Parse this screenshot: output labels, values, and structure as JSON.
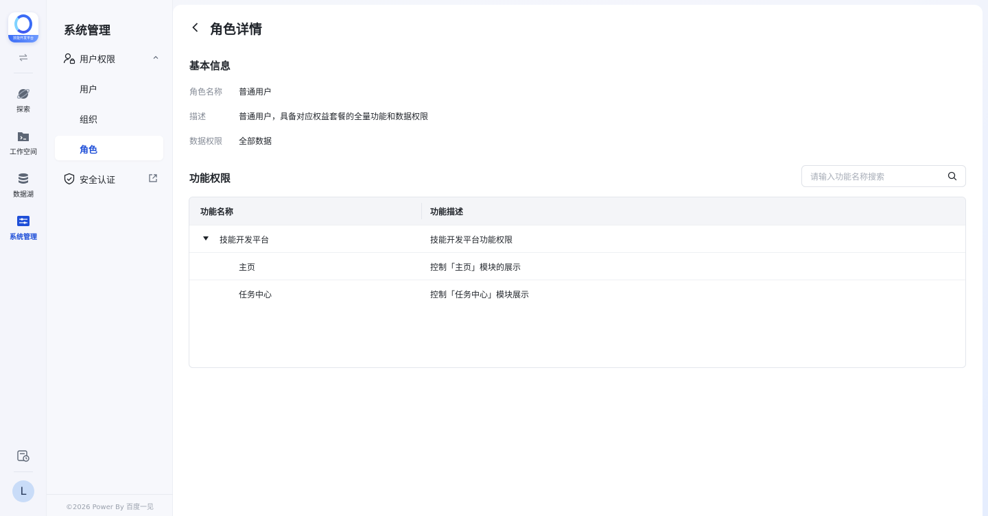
{
  "app": {
    "logo_text": "技能开发平台"
  },
  "rail": {
    "items": [
      {
        "label": "探索",
        "icon": "planet-icon"
      },
      {
        "label": "工作空间",
        "icon": "terminal-folder-icon"
      },
      {
        "label": "数据湖",
        "icon": "database-icon"
      },
      {
        "label": "系统管理",
        "icon": "system-settings-icon",
        "active": true
      }
    ],
    "avatar": "L"
  },
  "sidebar": {
    "title": "系统管理",
    "group": {
      "label": "用户权限",
      "expanded": true
    },
    "sub_items": [
      {
        "label": "用户"
      },
      {
        "label": "组织"
      },
      {
        "label": "角色",
        "active": true
      }
    ],
    "external_item": {
      "label": "安全认证"
    },
    "footer": "©2026 Power By 百度一见"
  },
  "main": {
    "title": "角色详情",
    "basic_info_title": "基本信息",
    "basic_info": [
      {
        "key": "角色名称",
        "value": "普通用户"
      },
      {
        "key": "描述",
        "value": "普通用户，具备对应权益套餐的全量功能和数据权限"
      },
      {
        "key": "数据权限",
        "value": "全部数据"
      }
    ],
    "permissions_title": "功能权限",
    "search": {
      "placeholder": "请输入功能名称搜索",
      "value": ""
    },
    "table": {
      "columns": [
        "功能名称",
        "功能描述"
      ],
      "rows": [
        {
          "name": "技能开发平台",
          "desc": "技能开发平台功能权限",
          "expandable": true,
          "expanded": true,
          "level": 0
        },
        {
          "name": "主页",
          "desc": "控制「主页」模块的展示",
          "level": 1
        },
        {
          "name": "任务中心",
          "desc": "控制「任务中心」模块展示",
          "level": 1
        }
      ]
    }
  },
  "colors": {
    "accent": "#1f4fd8",
    "text": "#1f2329",
    "muted": "#858b96"
  }
}
